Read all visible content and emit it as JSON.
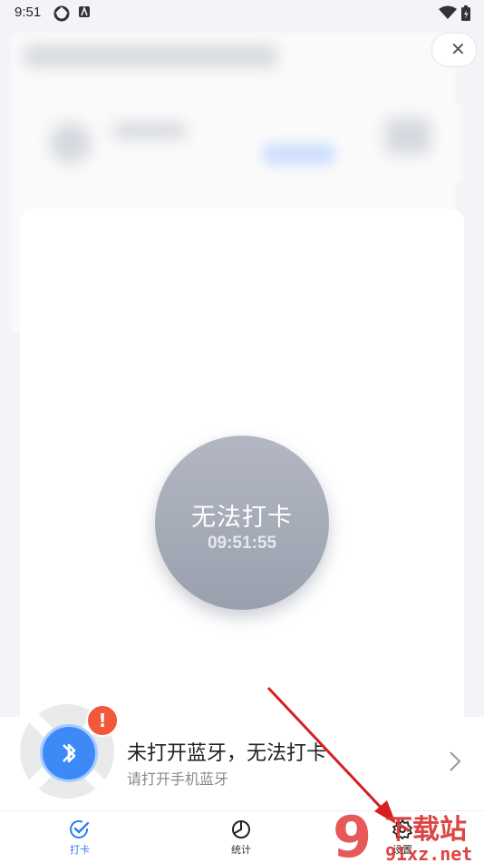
{
  "status_bar": {
    "time": "9:51"
  },
  "punch": {
    "title": "无法打卡",
    "time": "09:51:55"
  },
  "bluetooth_prompt": {
    "title": "未打开蓝牙，无法打卡",
    "subtitle": "请打开手机蓝牙"
  },
  "nav": {
    "items": [
      {
        "label": "打卡",
        "icon": "check-icon",
        "active": true
      },
      {
        "label": "统计",
        "icon": "pie-chart-icon",
        "active": false
      },
      {
        "label": "设置",
        "icon": "gear-icon",
        "active": false
      }
    ]
  },
  "watermark": {
    "text_top": "下载站",
    "text_bottom": "91xz.net"
  },
  "colors": {
    "accent": "#2f7cf6",
    "warning": "#f4583a",
    "button": "#a7acb8"
  }
}
